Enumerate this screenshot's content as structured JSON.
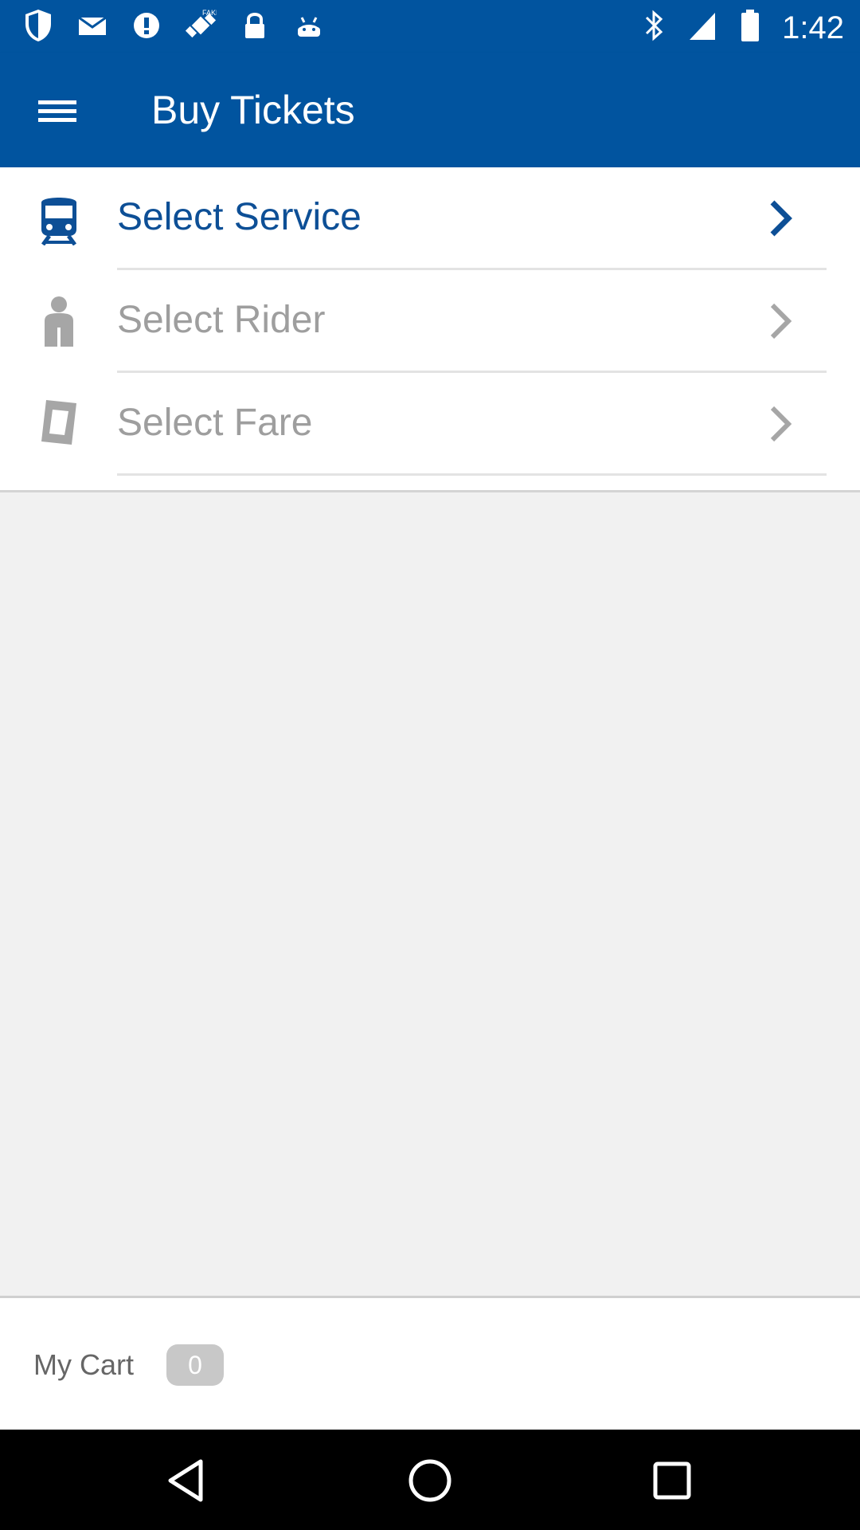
{
  "status_bar": {
    "time": "1:42",
    "icons_left": [
      "shield-icon",
      "mail-icon",
      "info-icon",
      "fake-gps-icon",
      "lock-icon",
      "android-icon"
    ],
    "icons_right": [
      "bluetooth-icon",
      "signal-icon",
      "battery-icon"
    ]
  },
  "app_bar": {
    "title": "Buy Tickets",
    "menu_icon": "hamburger-menu-icon",
    "background_color": "#01549f"
  },
  "steps": [
    {
      "label": "Select Service",
      "icon": "train-icon",
      "state": "active"
    },
    {
      "label": "Select Rider",
      "icon": "person-icon",
      "state": "inactive"
    },
    {
      "label": "Select Fare",
      "icon": "ticket-icon",
      "state": "inactive"
    }
  ],
  "cart": {
    "label": "My Cart",
    "count": "0"
  },
  "nav": {
    "back_icon": "back-triangle-icon",
    "home_icon": "home-circle-icon",
    "recents_icon": "recents-square-icon"
  },
  "colors": {
    "primary": "#01549f",
    "active_text": "#0d4f96",
    "inactive_text": "#9e9e9e",
    "inactive_icon": "#a6a6a6",
    "background": "#f1f1f1"
  }
}
